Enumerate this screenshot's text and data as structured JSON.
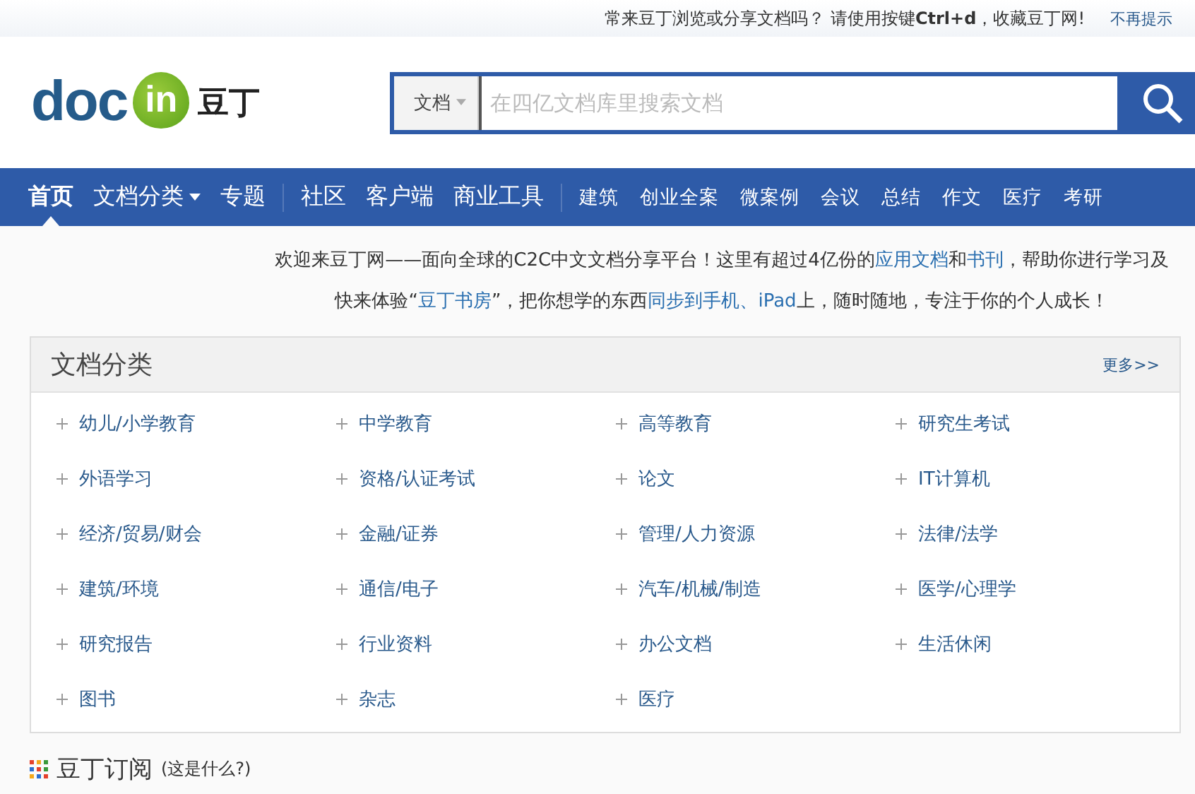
{
  "top_bar": {
    "message": "常来豆丁浏览或分享文档吗？ 请使用按键**Ctrl+d**，收藏豆丁网!",
    "dismiss": "不再提示"
  },
  "logo": {
    "latin": "doc",
    "badge": "in",
    "chinese": "豆丁"
  },
  "search": {
    "scope": "文档",
    "placeholder": "在四亿文档库里搜索文档"
  },
  "nav": {
    "groups": [
      {
        "kind": "primary",
        "items": [
          {
            "label": "首页",
            "selected": true,
            "dropdown": false
          },
          {
            "label": "文档分类",
            "selected": false,
            "dropdown": true
          },
          {
            "label": "专题",
            "selected": false,
            "dropdown": false
          }
        ]
      },
      {
        "kind": "primary",
        "items": [
          {
            "label": "社区",
            "selected": false,
            "dropdown": false
          },
          {
            "label": "客户端",
            "selected": false,
            "dropdown": false
          },
          {
            "label": "商业工具",
            "selected": false,
            "dropdown": false
          }
        ]
      },
      {
        "kind": "secondary",
        "items": [
          {
            "label": "建筑",
            "selected": false,
            "dropdown": false
          },
          {
            "label": "创业全案",
            "selected": false,
            "dropdown": false
          },
          {
            "label": "微案例",
            "selected": false,
            "dropdown": false
          },
          {
            "label": "会议",
            "selected": false,
            "dropdown": false
          },
          {
            "label": "总结",
            "selected": false,
            "dropdown": false
          },
          {
            "label": "作文",
            "selected": false,
            "dropdown": false
          },
          {
            "label": "医疗",
            "selected": false,
            "dropdown": false
          },
          {
            "label": "考研",
            "selected": false,
            "dropdown": false
          }
        ]
      }
    ]
  },
  "welcome": [
    [
      {
        "kind": "text",
        "text": "欢迎来豆丁网——面向全球的C2C中文文档分享平台！这里有超过4亿份的"
      },
      {
        "kind": "link",
        "text": "应用文档"
      },
      {
        "kind": "text",
        "text": "和"
      },
      {
        "kind": "link",
        "text": "书刊"
      },
      {
        "kind": "text",
        "text": "，帮助你进行学习及"
      }
    ],
    [
      {
        "kind": "text",
        "text": "快来体验“"
      },
      {
        "kind": "link",
        "text": "豆丁书房"
      },
      {
        "kind": "text",
        "text": "”，把你想学的东西"
      },
      {
        "kind": "link",
        "text": "同步到手机、iPad"
      },
      {
        "kind": "text",
        "text": "上，随时随地，专注于你的个人成长！"
      }
    ]
  ],
  "categories": {
    "title": "文档分类",
    "more": "更多>>",
    "items": [
      "幼儿/小学教育",
      "中学教育",
      "高等教育",
      "研究生考试",
      "外语学习",
      "资格/认证考试",
      "论文",
      "IT计算机",
      "经济/贸易/财会",
      "金融/证券",
      "管理/人力资源",
      "法律/法学",
      "建筑/环境",
      "通信/电子",
      "汽车/机械/制造",
      "医学/心理学",
      "研究报告",
      "行业资料",
      "办公文档",
      "生活休闲",
      "图书",
      "杂志",
      "医疗"
    ]
  },
  "subscription": {
    "title": "豆丁订阅",
    "hint": "(这是什么?)"
  }
}
